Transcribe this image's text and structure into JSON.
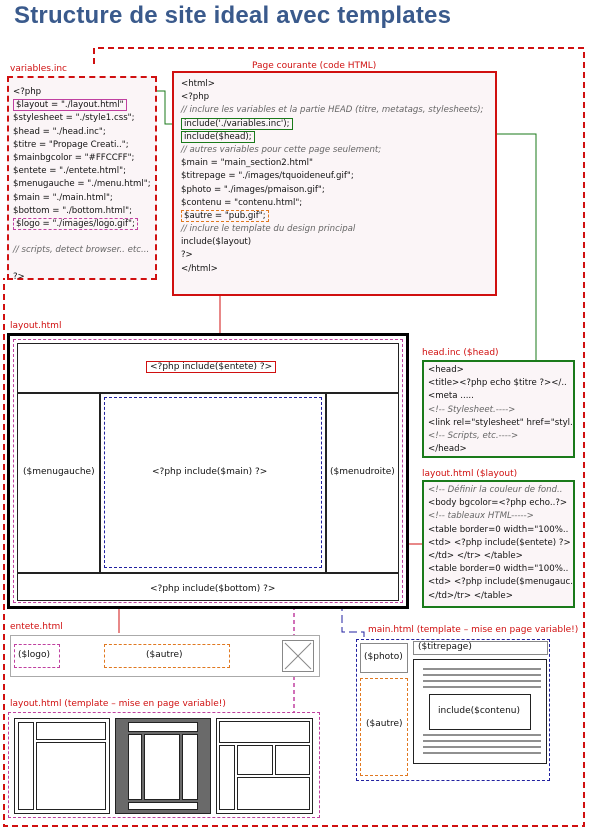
{
  "title": "Structure de site ideal avec templates",
  "variables_box": {
    "label": "variables.inc",
    "lines": [
      {
        "t": "<?php",
        "c": false
      },
      {
        "t": "$layout = \"./layout.html\"",
        "c": false
      },
      {
        "t": "$stylesheet = \"./style1.css\";",
        "c": false
      },
      {
        "t": "$head = \"./head.inc\";",
        "c": false
      },
      {
        "t": "$titre = \"Propage Creati..\";",
        "c": false
      },
      {
        "t": "$mainbgcolor = \"#FFCCFF\";",
        "c": false
      },
      {
        "t": "$entete = \"./entete.html\";",
        "c": false
      },
      {
        "t": "$menugauche = \"./menu.html\";",
        "c": false
      },
      {
        "t": "$main = \"./main.html\";",
        "c": false
      },
      {
        "t": "$bottom = \"./bottom.html\";",
        "c": false
      },
      {
        "t": "$logo = \"./images/logo.gif\";",
        "c": false
      },
      {
        "t": "",
        "c": false
      },
      {
        "t": "// scripts, detect browser.. etc...",
        "c": true
      },
      {
        "t": "",
        "c": false
      },
      {
        "t": "?>",
        "c": false
      }
    ]
  },
  "page_box": {
    "label": "Page courante (code HTML)",
    "lines": [
      {
        "t": "<html>",
        "c": false
      },
      {
        "t": "<?php",
        "c": false
      },
      {
        "t": "//  inclure les variables et la partie HEAD (titre, metatags, stylesheets);",
        "c": true
      },
      {
        "t": "include('./variables.inc');",
        "c": false
      },
      {
        "t": "include($head);",
        "c": false
      },
      {
        "t": "// autres variables pour cette page seulement;",
        "c": true
      },
      {
        "t": "$main = \"main_section2.html\"",
        "c": false
      },
      {
        "t": "$titrepage = \"./images/tquoideneuf.gif\";",
        "c": false
      },
      {
        "t": "$photo = \"./images/pmaison.gif\";",
        "c": false
      },
      {
        "t": "$contenu = \"contenu.html\";",
        "c": false
      },
      {
        "t": "$autre = \"pub.gif\";",
        "c": false
      },
      {
        "t": "// inclure le template du design principal",
        "c": true
      },
      {
        "t": "include($layout)",
        "c": false
      },
      {
        "t": "?>",
        "c": false
      },
      {
        "t": "</html>",
        "c": false
      }
    ]
  },
  "layout_box": {
    "label": "layout.html",
    "entete": "<?php include($entete) ?>",
    "menugauche": "($menugauche)",
    "main": "<?php include($main) ?>",
    "menudroite": "($menudroite)",
    "bottom": "<?php include($bottom) ?>"
  },
  "head_box": {
    "label": "head.inc ($head)",
    "lines": [
      {
        "t": "<head>",
        "c": false
      },
      {
        "t": "<title><?php echo $titre ?></..",
        "c": false
      },
      {
        "t": "<meta .....",
        "c": false
      },
      {
        "t": "<!-- Stylesheet.---->",
        "c": true
      },
      {
        "t": "<link rel=\"stylesheet\" href=\"styl..",
        "c": false
      },
      {
        "t": "<!-- Scripts, etc.---->",
        "c": true
      },
      {
        "t": "</head>",
        "c": false
      }
    ]
  },
  "layout_code_box": {
    "label": "layout.html ($layout)",
    "lines": [
      {
        "t": "<!-- Définir la couleur de fond..",
        "c": true
      },
      {
        "t": "<body bgcolor=<?php echo..?>",
        "c": false
      },
      {
        "t": "<!-- tableaux HTML----->",
        "c": true
      },
      {
        "t": "<table border=0 width=\"100%..",
        "c": false
      },
      {
        "t": "<td> <?php include($entete) ?>",
        "c": false
      },
      {
        "t": "</td> </tr> </table>",
        "c": false
      },
      {
        "t": "<table border=0 width=\"100%..",
        "c": false
      },
      {
        "t": "<td> <?php include($menugauc..",
        "c": false
      },
      {
        "t": "</td>/tr> </table>",
        "c": false
      }
    ]
  },
  "entete_box": {
    "label": "entete.html",
    "logo": "($logo)",
    "autre": "($autre)"
  },
  "main_box": {
    "label": "main.html (template – mise en page variable!)",
    "photo": "($photo)",
    "titrepage": "($titrepage)",
    "autre": "($autre)",
    "contenu": "include($contenu)"
  },
  "templates_box": {
    "label": "layout.html (template – mise en page variable!)"
  },
  "colors": {
    "title": "#3a5a8c",
    "red": "#d01010",
    "green": "#1a7a1a",
    "pink": "#c040a0",
    "orange": "#e07820",
    "navy": "#2020a0"
  }
}
